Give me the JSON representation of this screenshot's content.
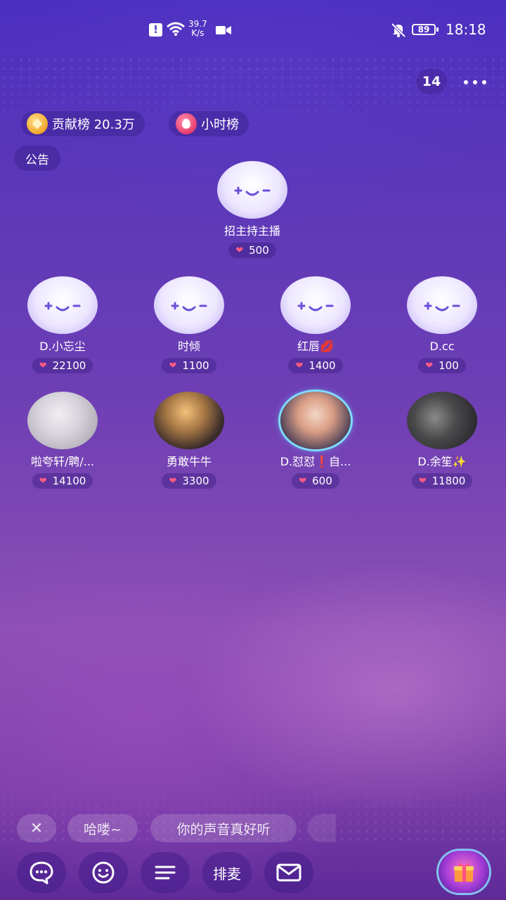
{
  "status_bar": {
    "alert_icon": "alert-square-icon",
    "net_speed_value": "39.7",
    "net_speed_unit": "K/s",
    "battery": "89",
    "time": "18:18"
  },
  "room": {
    "online_count": "14",
    "contribution_label": "贡献榜 20.3万",
    "hour_rank_label": "小时榜",
    "notice_label": "公告"
  },
  "host_seat": {
    "name": "招主持主播",
    "score": "500"
  },
  "seats": [
    {
      "name": "D.小忘尘",
      "score": "22100",
      "avatar": "placeholder"
    },
    {
      "name": "时倾",
      "score": "1100",
      "avatar": "placeholder"
    },
    {
      "name": "红唇💋",
      "score": "1400",
      "avatar": "placeholder"
    },
    {
      "name": "D.cc",
      "score": "100",
      "avatar": "placeholder"
    },
    {
      "name": "啦夸轩/聘/...",
      "score": "14100",
      "avatar": "photo"
    },
    {
      "name": "勇敢牛牛",
      "score": "3300",
      "avatar": "photo"
    },
    {
      "name": "D.怼怼❗自...",
      "score": "600",
      "avatar": "photo"
    },
    {
      "name": "D.余笙✨",
      "score": "11800",
      "avatar": "photo"
    }
  ],
  "quick_replies": {
    "close": "✕",
    "reply_1": "哈喽~",
    "reply_2": "你的声音真好听"
  },
  "toolbar": {
    "mic_queue_label": "排麦",
    "icons": [
      "chat-icon",
      "emoji-icon",
      "menu-icon",
      "mail-icon",
      "gift-icon"
    ]
  }
}
